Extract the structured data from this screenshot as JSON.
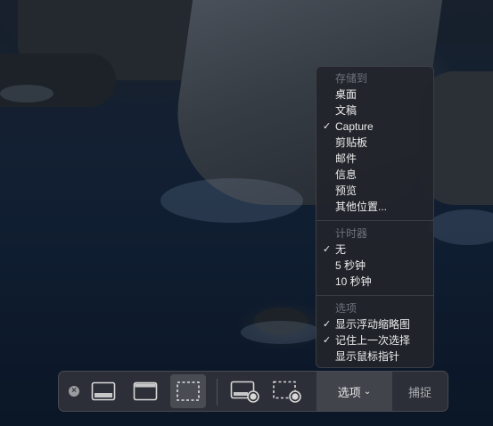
{
  "menu": {
    "section_save": {
      "header": "存储到",
      "items": [
        {
          "label": "桌面",
          "checked": false
        },
        {
          "label": "文稿",
          "checked": false
        },
        {
          "label": "Capture",
          "checked": true
        },
        {
          "label": "剪贴板",
          "checked": false
        },
        {
          "label": "邮件",
          "checked": false
        },
        {
          "label": "信息",
          "checked": false
        },
        {
          "label": "预览",
          "checked": false
        },
        {
          "label": "其他位置...",
          "checked": false
        }
      ]
    },
    "section_timer": {
      "header": "计时器",
      "items": [
        {
          "label": "无",
          "checked": true
        },
        {
          "label": "5 秒钟",
          "checked": false
        },
        {
          "label": "10 秒钟",
          "checked": false
        }
      ]
    },
    "section_options": {
      "header": "选项",
      "items": [
        {
          "label": "显示浮动缩略图",
          "checked": true
        },
        {
          "label": "记住上一次选择",
          "checked": true
        },
        {
          "label": "显示鼠标指针",
          "checked": false
        }
      ]
    },
    "check_glyph": "✓"
  },
  "toolbar": {
    "close_glyph": "×",
    "tools": [
      {
        "icon": "capture-entire-screen-icon"
      },
      {
        "icon": "capture-window-icon"
      },
      {
        "icon": "capture-selection-icon",
        "selected": true
      },
      {
        "icon": "record-entire-screen-icon"
      },
      {
        "icon": "record-selection-icon"
      }
    ],
    "options_label": "选项",
    "options_chevron": "⌄",
    "capture_label": "捕捉"
  },
  "colors": {
    "menu_bg": "#22242a",
    "toolbar_bg": "#303238",
    "text": "#ececec",
    "header_text": "#6e737b"
  }
}
